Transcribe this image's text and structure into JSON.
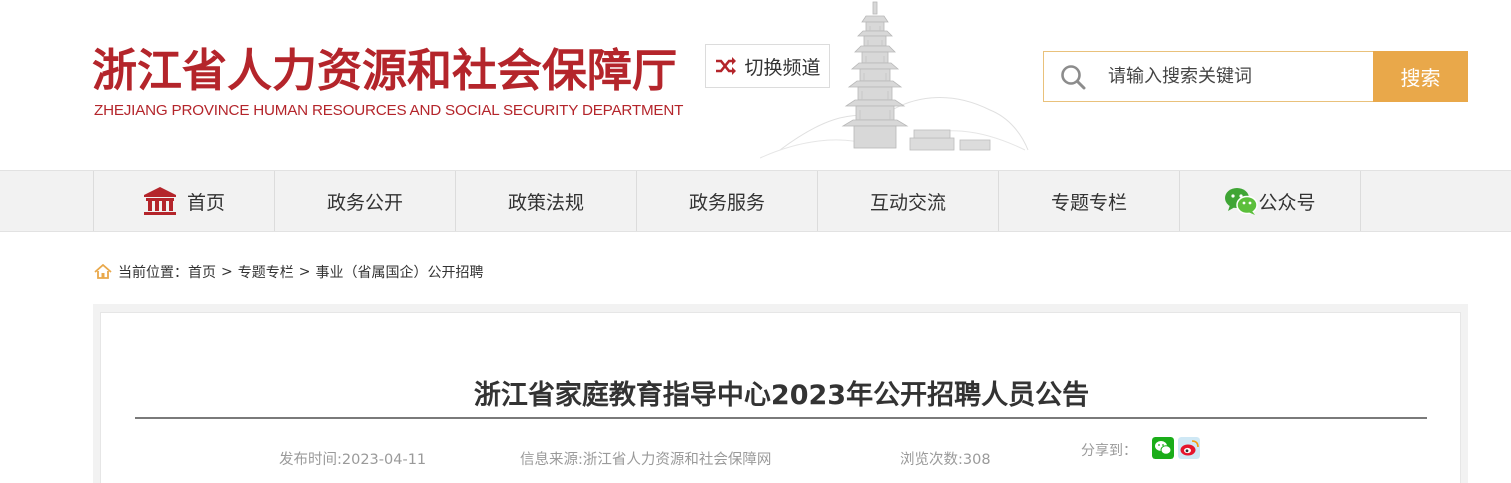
{
  "header": {
    "site_name_cn": "浙江省人力资源和社会保障厅",
    "site_name_en": "ZHEJIANG PROVINCE HUMAN RESOURCES AND SOCIAL SECURITY DEPARTMENT",
    "switch_channel_label": "切换频道"
  },
  "search": {
    "placeholder": "请输入搜索关键词",
    "button_label": "搜索"
  },
  "nav": {
    "items": [
      {
        "label": "首页",
        "icon": "home-building-icon"
      },
      {
        "label": "政务公开"
      },
      {
        "label": "政策法规"
      },
      {
        "label": "政务服务"
      },
      {
        "label": "互动交流"
      },
      {
        "label": "专题专栏"
      },
      {
        "label": "公众号",
        "icon": "wechat-icon"
      }
    ]
  },
  "breadcrumb": {
    "prefix": "当前位置：",
    "items": [
      "首页",
      "专题专栏",
      "事业（省属国企）公开招聘"
    ],
    "separator": ">"
  },
  "article": {
    "title": "浙江省家庭教育指导中心2023年公开招聘人员公告",
    "publish_time": "发布时间:2023-04-11",
    "source": "信息来源:浙江省人力资源和社会保障网",
    "views": "浏览次数:308",
    "share_label": "分享到："
  },
  "colors": {
    "brand_red": "#b4252b",
    "search_button": "#e9a84a",
    "nav_background": "#f2f2f2",
    "wechat_green": "#1aad19",
    "weibo_red": "#e6162d"
  }
}
